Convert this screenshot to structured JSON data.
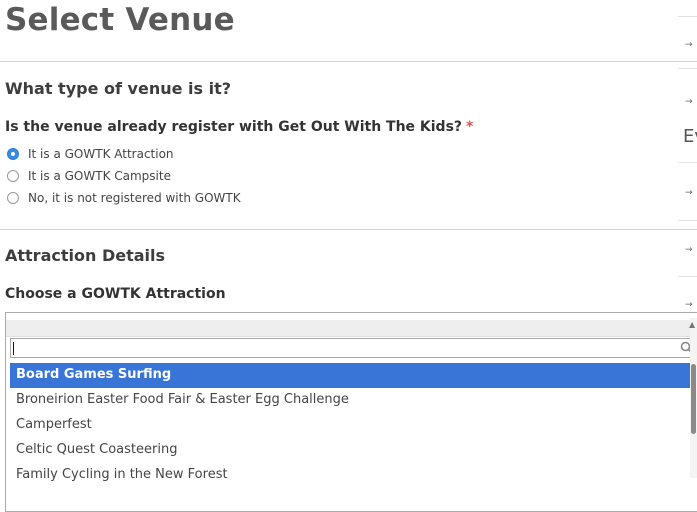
{
  "page": {
    "title": "Select Venue"
  },
  "venue_type": {
    "heading": "What type of venue is it?",
    "question": "Is the venue already register with Get Out With The Kids?",
    "required_mark": "*",
    "options": [
      {
        "label": "It is a GOWTK Attraction",
        "checked": true
      },
      {
        "label": "It is a GOWTK Campsite",
        "checked": false
      },
      {
        "label": "No, it is not registered with GOWTK",
        "checked": false
      }
    ]
  },
  "attraction": {
    "heading": "Attraction Details",
    "field_label": "Choose a GOWTK Attraction",
    "search_value": "",
    "results": [
      {
        "label": "Board Games Surfing",
        "highlighted": true
      },
      {
        "label": "Broneirion Easter Food Fair & Easter Egg Challenge",
        "highlighted": false
      },
      {
        "label": "Camperfest",
        "highlighted": false
      },
      {
        "label": "Celtic Quest Coasteering",
        "highlighted": false
      },
      {
        "label": "Family Cycling in the New Forest",
        "highlighted": false
      }
    ]
  },
  "right_column": {
    "partial_letter": "Ev",
    "arrow": "→"
  },
  "icons": {
    "search": "search-icon",
    "scroll_up": "scroll-up-icon"
  },
  "colors": {
    "accent": "#3875d7",
    "radio_checked": "#3b8ae3",
    "required": "#d9534f"
  }
}
